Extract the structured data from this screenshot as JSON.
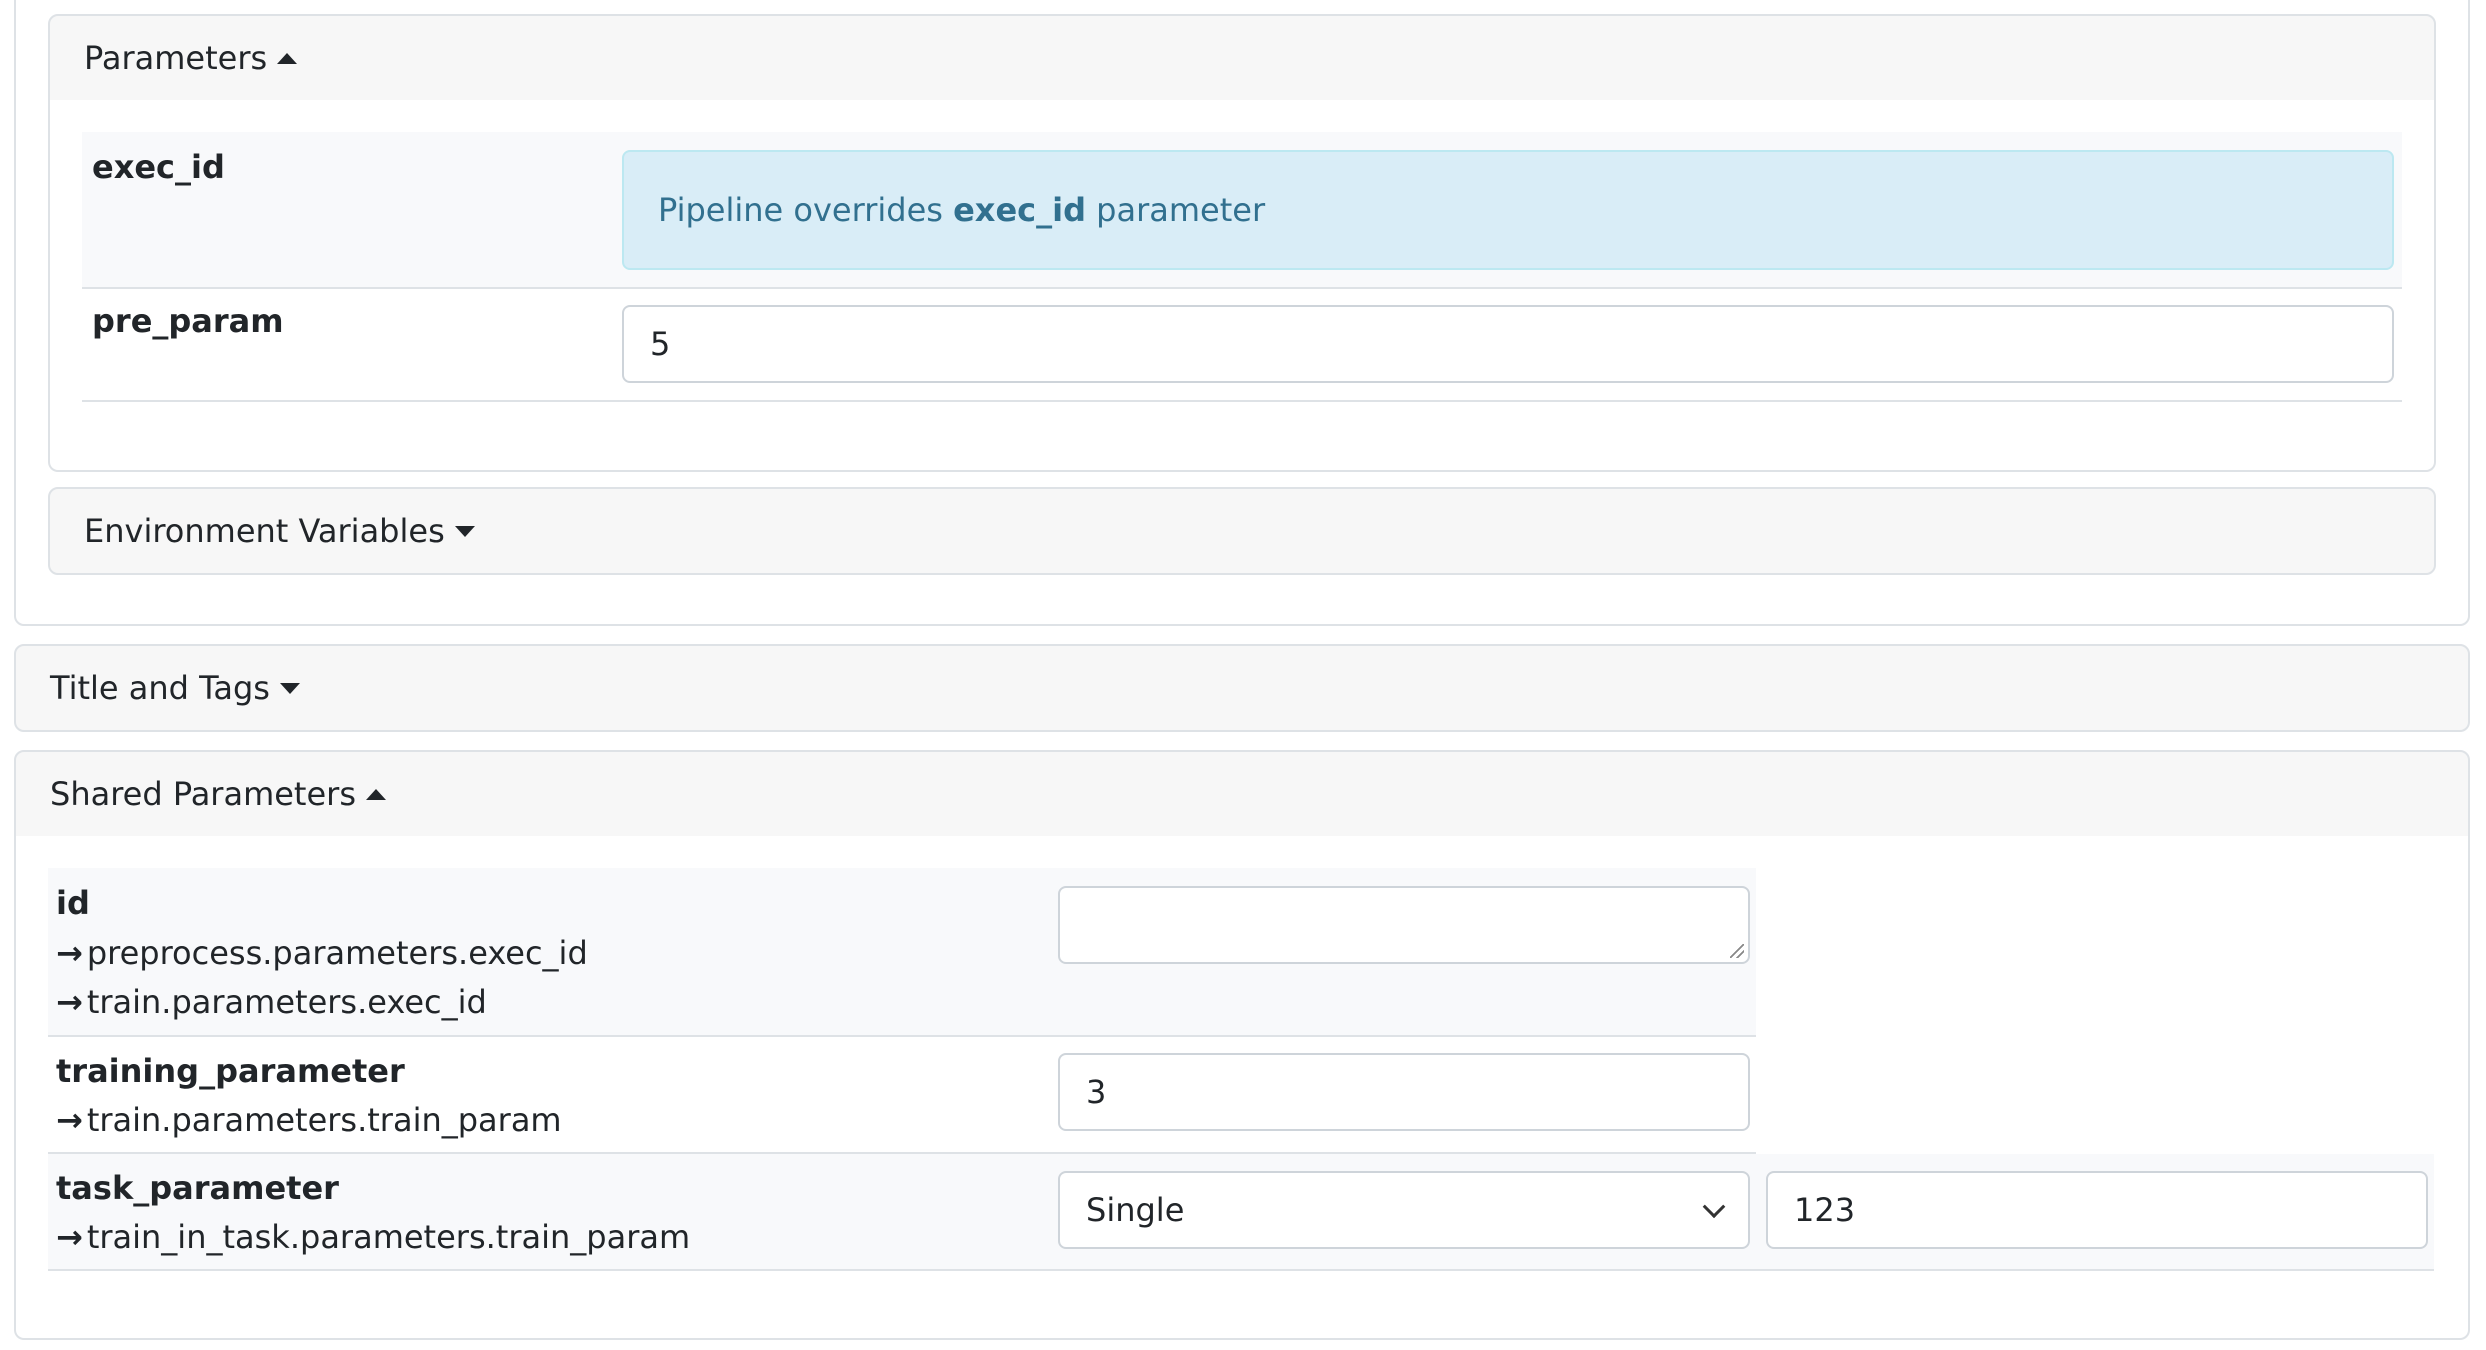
{
  "parameters_section": {
    "header": "Parameters",
    "rows": [
      {
        "name": "exec_id",
        "notice_prefix": "Pipeline overrides ",
        "notice_bold": "exec_id",
        "notice_suffix": " parameter"
      },
      {
        "name": "pre_param",
        "value": "5"
      }
    ]
  },
  "environment_section": {
    "header": "Environment Variables"
  },
  "title_tags_section": {
    "header": "Title and Tags"
  },
  "shared_section": {
    "header": "Shared Parameters",
    "arrow": "→",
    "rows": [
      {
        "name": "id",
        "mappings": [
          "preprocess.parameters.exec_id",
          "train.parameters.exec_id"
        ],
        "value": ""
      },
      {
        "name": "training_parameter",
        "mappings": [
          "train.parameters.train_param"
        ],
        "value": "3"
      },
      {
        "name": "task_parameter",
        "mappings": [
          "train_in_task.parameters.train_param"
        ],
        "mode": "Single",
        "value": "123"
      }
    ]
  }
}
